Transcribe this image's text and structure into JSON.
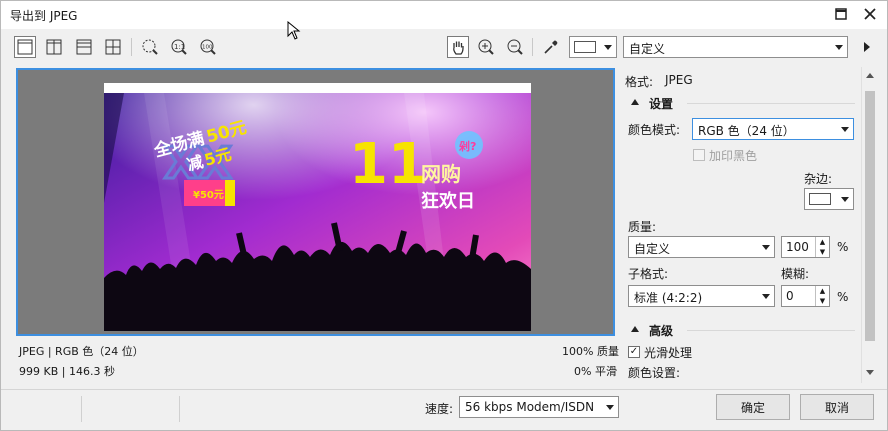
{
  "window": {
    "title": "导出到 JPEG"
  },
  "toolbar": {
    "preset": "自定义"
  },
  "poster": {
    "line1": "全场满",
    "line1_num": "50元",
    "line2": "减",
    "line2_num": "5元",
    "coupon_value": "¥50元",
    "big_num": "11",
    "words1": "网购",
    "words2": "狂欢日",
    "bubble": "剁?"
  },
  "preview_info": {
    "format_line": "JPEG | RGB 色（24 位）",
    "size_line": "999 KB | 146.3 秒",
    "quality_line": "100% 质量",
    "smooth_line": "0% 平滑"
  },
  "panel": {
    "format_label": "格式:",
    "format_value": "JPEG",
    "settings_header": "设置",
    "color_mode_label": "颜色模式:",
    "color_mode_value": "RGB 色（24 位）",
    "add_black_label": "加印黑色",
    "matte_label": "杂边:",
    "quality_label": "质量:",
    "quality_preset": "自定义",
    "quality_value": "100",
    "percent": "%",
    "subformat_label": "子格式:",
    "blur_label": "模糊:",
    "subformat_value": "标准 (4:2:2)",
    "blur_value": "0",
    "advanced_header": "高级",
    "antialias_label": "光滑处理",
    "color_settings_label": "颜色设置:"
  },
  "footer": {
    "speed_label": "速度:",
    "speed_value": "56 kbps Modem/ISDN",
    "ok_label": "确定",
    "cancel_label": "取消"
  }
}
